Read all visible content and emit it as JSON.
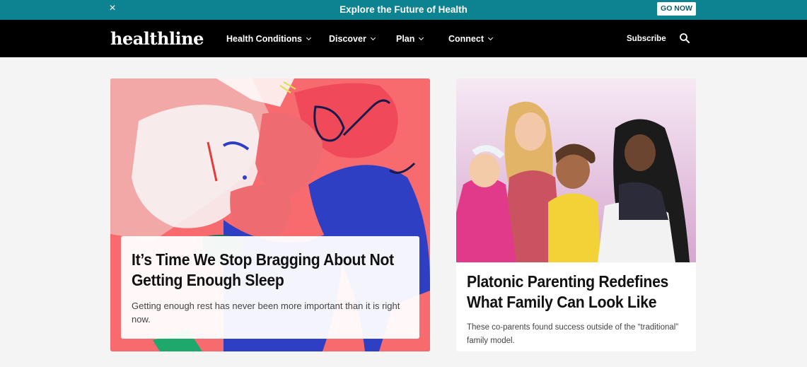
{
  "promo": {
    "text": "Explore the Future of Health",
    "button": "GO NOW",
    "close": "×"
  },
  "nav": {
    "logo": "healthline",
    "items": [
      {
        "label": "Health Conditions"
      },
      {
        "label": "Discover"
      },
      {
        "label": "Plan"
      },
      {
        "label": "Connect"
      }
    ],
    "subscribe": "Subscribe",
    "search_icon": "search-icon"
  },
  "articles": [
    {
      "title": "It’s Time We Stop Bragging About Not Getting Enough Sleep",
      "dek": "Getting enough rest has never been more important than it is right now."
    },
    {
      "title": "Platonic Parenting Redefines What Family Can Look Like",
      "dek": "These co-parents found success outside of the “traditional” family model."
    }
  ],
  "colors": {
    "promo_bg": "#0d8290",
    "nav_bg": "#000000",
    "page_bg": "#f4f4f4",
    "illustration_coral": "#f76b6f",
    "illustration_blue": "#2f3fc4"
  }
}
